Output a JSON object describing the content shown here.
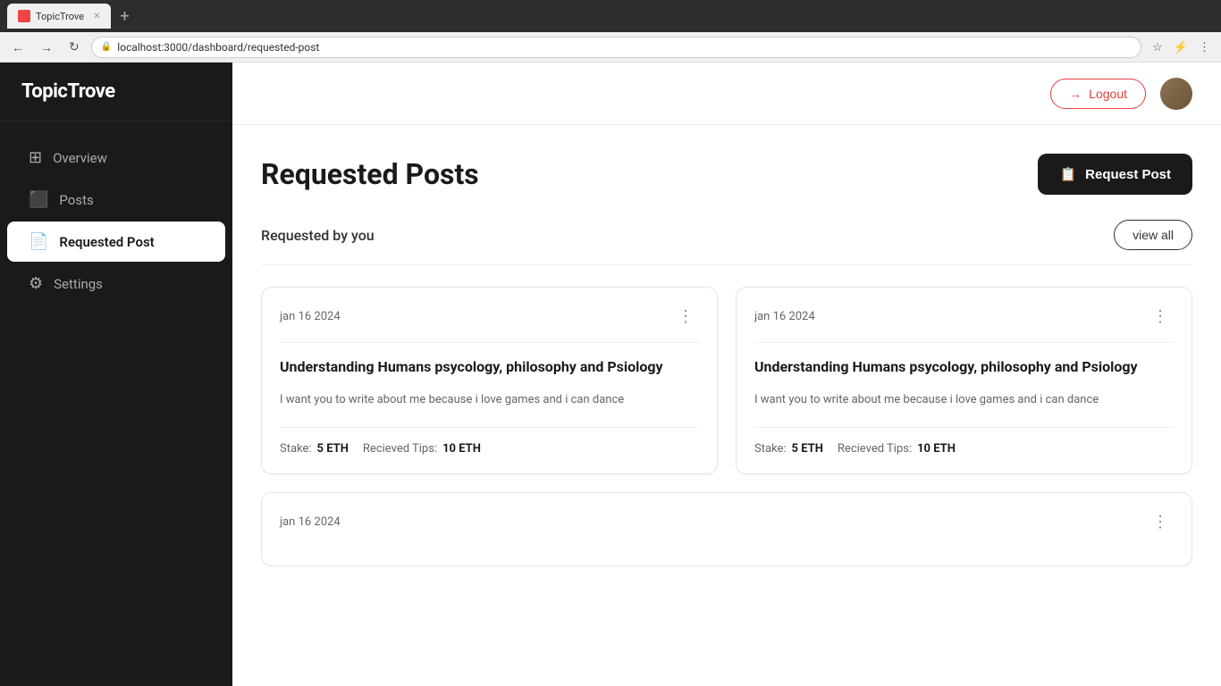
{
  "browser": {
    "url": "localhost:3000/dashboard/requested-post",
    "tab_title": "TopicTrove"
  },
  "sidebar": {
    "logo": "TopicTrove",
    "nav_items": [
      {
        "id": "overview",
        "label": "Overview",
        "icon": "⊞",
        "active": false
      },
      {
        "id": "posts",
        "label": "Posts",
        "icon": "⬛",
        "active": false
      },
      {
        "id": "requested-post",
        "label": "Requested Post",
        "icon": "📄",
        "active": true
      },
      {
        "id": "settings",
        "label": "Settings",
        "icon": "⚙",
        "active": false
      }
    ]
  },
  "header": {
    "logout_label": "Logout",
    "logout_icon": "→"
  },
  "page": {
    "title": "Requested Posts",
    "request_post_button": "Request Post",
    "section_title": "Requested by you",
    "view_all_label": "view all"
  },
  "cards": [
    {
      "date": "jan 16 2024",
      "title": "Understanding Humans psycology, philosophy and Psiology",
      "description": "I want you to write about me because i love games and i can dance",
      "stake_label": "Stake:",
      "stake_value": "5 ETH",
      "tips_label": "Recieved Tips:",
      "tips_value": "10 ETH"
    },
    {
      "date": "jan 16 2024",
      "title": "Understanding Humans psycology, philosophy and Psiology",
      "description": "I want you to write about me because i love games and i can dance",
      "stake_label": "Stake:",
      "stake_value": "5 ETH",
      "tips_label": "Recieved Tips:",
      "tips_value": "10 ETH"
    }
  ],
  "partial_card": {
    "date": "jan 16 2024"
  }
}
